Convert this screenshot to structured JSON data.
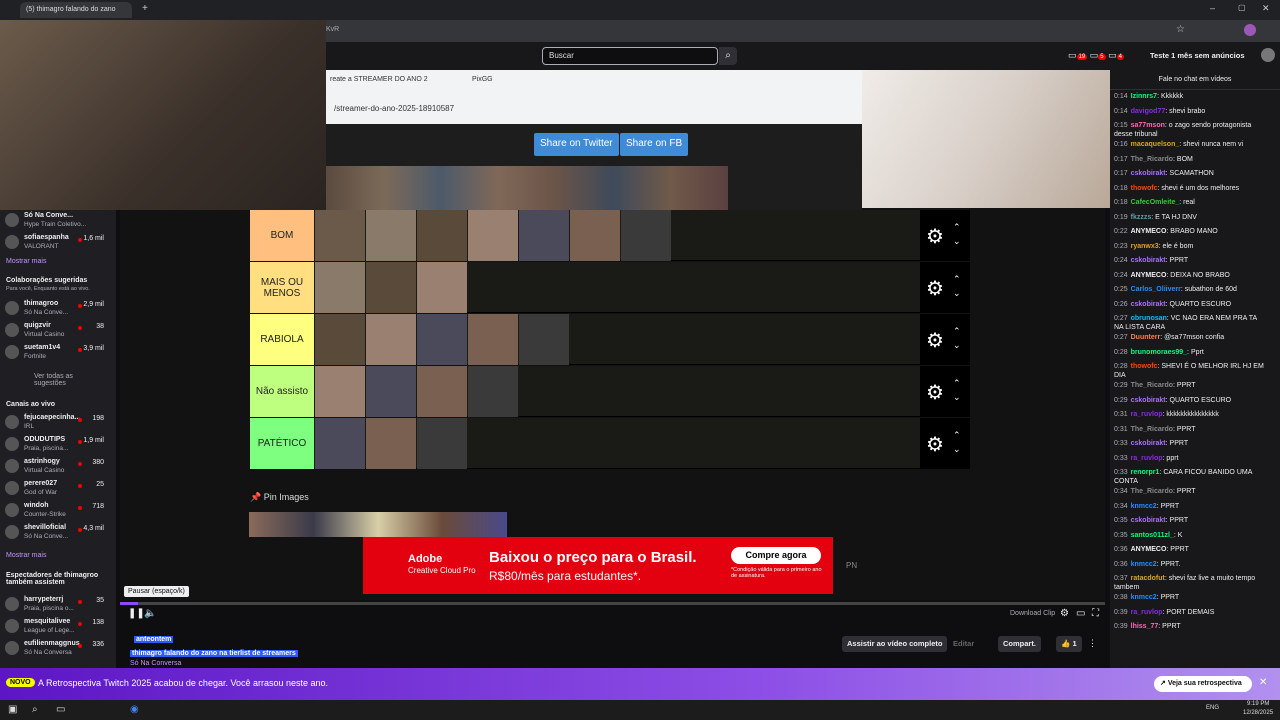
{
  "browser": {
    "tab_title": "(5) thimagro falando do zano",
    "url_fragment": "KvR"
  },
  "twitch": {
    "search_placeholder": "Buscar",
    "notif_counts": [
      "19",
      "5",
      "4"
    ],
    "prime_label": "Teste 1 mês sem anúncios"
  },
  "sidebar": {
    "top_items": [
      {
        "name": "Só Na Conve...",
        "game": "Hype Train Coletivo...",
        "viewers": ""
      },
      {
        "name": "sofiaespanha",
        "game": "VALORANT",
        "viewers": "1,6 mil"
      }
    ],
    "show_more": "Mostrar mais",
    "collab_title": "Colaborações sugeridas",
    "collab_sub": "Para você, Enquanto está ao vivo.",
    "collab_items": [
      {
        "name": "thimagroo",
        "game": "Só Na Conve...",
        "viewers": "2,9 mil"
      },
      {
        "name": "quigzvir",
        "game": "Virtual Casino",
        "viewers": "38"
      },
      {
        "name": "suetam1v4",
        "game": "Fortnite",
        "viewers": "3,9 mil"
      }
    ],
    "see_all": "Ver todas as sugestões",
    "live_title": "Canais ao vivo",
    "live_items": [
      {
        "name": "fejucaepecinha...",
        "game": "IRL",
        "viewers": "198"
      },
      {
        "name": "ODUDUTIPS",
        "game": "Praia, piscina...",
        "viewers": "1,9 mil"
      },
      {
        "name": "astrinhogy",
        "game": "Virtual Casino",
        "viewers": "380"
      },
      {
        "name": "perere027",
        "game": "God of War",
        "viewers": "25"
      },
      {
        "name": "windoh",
        "game": "Counter-Strike",
        "viewers": "718"
      },
      {
        "name": "shevilloficial",
        "game": "Só Na Conve...",
        "viewers": "4,3 mil"
      }
    ],
    "show_more2": "Mostrar mais",
    "viewers_title": "Espectadores de thimagroo também assistem",
    "viewer_items": [
      {
        "name": "harrypeterrj",
        "game": "Praia, piscina o...",
        "viewers": "35"
      },
      {
        "name": "mesquitalivee",
        "game": "League of Lege...",
        "viewers": "138"
      },
      {
        "name": "eufilienmaggnus",
        "game": "Só Na Conversa",
        "viewers": "336"
      }
    ]
  },
  "tierlist": {
    "url": "/streamer-do-ano-2025-18910587",
    "tab1": "reate a STREAMER DO ANO 2",
    "tab2": "PixGG",
    "share_twitter": "Share on Twitter",
    "share_fb": "Share on FB",
    "rows": [
      {
        "label": "BOM",
        "color": "#ffbf7f",
        "thumbs": 7
      },
      {
        "label": "MAIS OU MENOS",
        "color": "#ffdf7f",
        "thumbs": 3
      },
      {
        "label": "RABIOLA",
        "color": "#ffff7f",
        "thumbs": 5
      },
      {
        "label": "Não assisto",
        "color": "#bfff7f",
        "thumbs": 4
      },
      {
        "label": "PATÉTICO",
        "color": "#7fff7f",
        "thumbs": 3
      }
    ],
    "pin_images": "Pin Images"
  },
  "ad": {
    "brand": "Adobe",
    "product": "Creative Cloud Pro",
    "headline": "Baixou o preço para o Brasil.",
    "price": "R$80/mês para estudantes*.",
    "cta": "Compre agora",
    "fine": "*Condição válida para o primeiro ano de assinatura."
  },
  "player": {
    "tooltip": "Pausar (espaço/k)",
    "download_clip": "Download Clip",
    "progress_fraction": 0.018
  },
  "clip_info": {
    "date": "anteontem",
    "title": "thimagro falando do zano na tierlist de streamers",
    "category": "Só Na Conversa",
    "watch_full": "Assistir ao vídeo completo",
    "edit": "Editar",
    "share": "Compart.",
    "likes": "1"
  },
  "chat": {
    "header": "Fale no chat em vídeos",
    "messages": [
      {
        "t": "0:14",
        "u": "Izinnrs7",
        "c": "#00ff7f",
        "m": "Kkkkkk"
      },
      {
        "t": "0:14",
        "u": "davigod77",
        "c": "#8a2be2",
        "m": "shevi brabo"
      },
      {
        "t": "0:15",
        "u": "sa77mson",
        "c": "#ff69b4",
        "m": "o zago sendo protagonista desse tribunal"
      },
      {
        "t": "0:16",
        "u": "macaquelson_",
        "c": "#daa520",
        "m": "shevi nunca nem vi"
      },
      {
        "t": "0:17",
        "u": "The_Ricardo",
        "c": "#888",
        "m": "BOM"
      },
      {
        "t": "0:17",
        "u": "cskobirakt",
        "c": "#a970ff",
        "m": "SCAMATHON"
      },
      {
        "t": "0:18",
        "u": "thowofc",
        "c": "#ff4500",
        "m": "shevi é um dos melhores"
      },
      {
        "t": "0:18",
        "u": "CafecOmleite_",
        "c": "#32cd32",
        "m": "real"
      },
      {
        "t": "0:19",
        "u": "fkzzzs",
        "c": "#5f9ea0",
        "m": "E TA HJ DNV"
      },
      {
        "t": "0:22",
        "u": "ANYMECO",
        "c": "#efeff1",
        "m": "BRABO MANO"
      },
      {
        "t": "0:23",
        "u": "ryanwx3",
        "c": "#daa520",
        "m": "ele é bom"
      },
      {
        "t": "0:24",
        "u": "cskobirakt",
        "c": "#a970ff",
        "m": "PPRT"
      },
      {
        "t": "0:24",
        "u": "ANYMECO",
        "c": "#efeff1",
        "m": "DEIXA NO BRABO"
      },
      {
        "t": "0:25",
        "u": "Carlos_Oliiverr",
        "c": "#1e90ff",
        "m": "subathon de 60d"
      },
      {
        "t": "0:26",
        "u": "cskobirakt",
        "c": "#a970ff",
        "m": "QUARTO ESCURO"
      },
      {
        "t": "0:27",
        "u": "obrunosan",
        "c": "#00bfff",
        "m": "VC NAO ERA NEM PRA TA NA LISTA CARA"
      },
      {
        "t": "0:27",
        "u": "Duunterr",
        "c": "#ff7f50",
        "m": "@sa77mson confia"
      },
      {
        "t": "0:28",
        "u": "brunomoraes99_",
        "c": "#00ff7f",
        "m": "Pprt"
      },
      {
        "t": "0:28",
        "u": "thowofc",
        "c": "#ff4500",
        "m": "SHEVI É O MELHOR IRL HJ EM DIA"
      },
      {
        "t": "0:29",
        "u": "The_Ricardo",
        "c": "#888",
        "m": "PPRT"
      },
      {
        "t": "0:29",
        "u": "cskobirakt",
        "c": "#a970ff",
        "m": "QUARTO ESCURO"
      },
      {
        "t": "0:31",
        "u": "ra_ruvlop",
        "c": "#8a2be2",
        "m": "kkkkkkkkkkkkkkk"
      },
      {
        "t": "0:31",
        "u": "The_Ricardo",
        "c": "#888",
        "m": "PPRT"
      },
      {
        "t": "0:33",
        "u": "cskobirakt",
        "c": "#a970ff",
        "m": "PPRT"
      },
      {
        "t": "0:33",
        "u": "ra_ruvlop",
        "c": "#8a2be2",
        "m": "pprt"
      },
      {
        "t": "0:33",
        "u": "renorpr1",
        "c": "#00ff7f",
        "m": "CARA FICOU BANIDO UMA CONTA"
      },
      {
        "t": "0:34",
        "u": "The_Ricardo",
        "c": "#888",
        "m": "PPRT"
      },
      {
        "t": "0:34",
        "u": "knmcc2",
        "c": "#1e90ff",
        "m": "PPRT"
      },
      {
        "t": "0:35",
        "u": "cskobirakt",
        "c": "#a970ff",
        "m": "PPRT"
      },
      {
        "t": "0:35",
        "u": "santos011zl_",
        "c": "#00ff7f",
        "m": "K"
      },
      {
        "t": "0:36",
        "u": "ANYMECO",
        "c": "#efeff1",
        "m": "PPRT"
      },
      {
        "t": "0:36",
        "u": "knmcc2",
        "c": "#1e90ff",
        "m": "PPRT."
      },
      {
        "t": "0:37",
        "u": "ratacdofut",
        "c": "#daa520",
        "m": "shevi faz live a muito tempo tambem"
      },
      {
        "t": "0:38",
        "u": "knmcc2",
        "c": "#1e90ff",
        "m": "PPRT"
      },
      {
        "t": "0:39",
        "u": "ra_ruvlop",
        "c": "#8a2be2",
        "m": "PORT DEMAIS"
      },
      {
        "t": "0:39",
        "u": "lhiss_77",
        "c": "#ff69b4",
        "m": "PPRT"
      }
    ]
  },
  "banner": {
    "badge": "NOVO",
    "text": "A Retrospectiva Twitch 2025 acabou de chegar. Você arrasou neste ano.",
    "button": "Veja sua retrospectiva"
  },
  "taskbar": {
    "time": "9:19 PM",
    "date": "12/28/2025",
    "lang": "ENG"
  }
}
